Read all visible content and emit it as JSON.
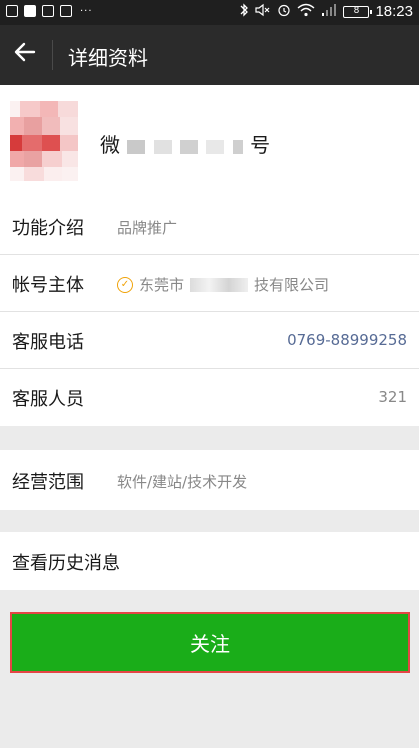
{
  "status_bar": {
    "time": "18:23",
    "battery": "8",
    "left_icons": [
      "notification-icon",
      "app-icon",
      "mail-icon",
      "mail-icon"
    ],
    "right_icons": [
      "bluetooth-icon",
      "mute-icon",
      "alarm-icon",
      "wifi-icon",
      "signal-icon",
      "battery-icon"
    ],
    "more": "···"
  },
  "header": {
    "title": "详细资料",
    "back_icon": "back-arrow-icon"
  },
  "profile": {
    "name_prefix": "微",
    "name_suffix": "号"
  },
  "info_rows": [
    {
      "label": "功能介绍",
      "value": "品牌推广"
    },
    {
      "label": "帐号主体",
      "value_prefix": "东莞市",
      "value_suffix": "技有限公司",
      "verified_icon": "verified-icon"
    },
    {
      "label": "客服电话",
      "value": "0769-88999258"
    },
    {
      "label": "客服人员",
      "value": "321"
    }
  ],
  "scope": {
    "label": "经营范围",
    "value": "软件/建站/技术开发"
  },
  "history": {
    "label": "查看历史消息"
  },
  "follow_button": {
    "label": "关注"
  },
  "colors": {
    "header_bg": "#2b2b2b",
    "status_bg": "#1f1f1f",
    "page_bg": "#ebebeb",
    "primary_green": "#1aad19",
    "link_blue": "#576b95",
    "verify_orange": "#f0a30a",
    "highlight_red": "#e54545"
  }
}
